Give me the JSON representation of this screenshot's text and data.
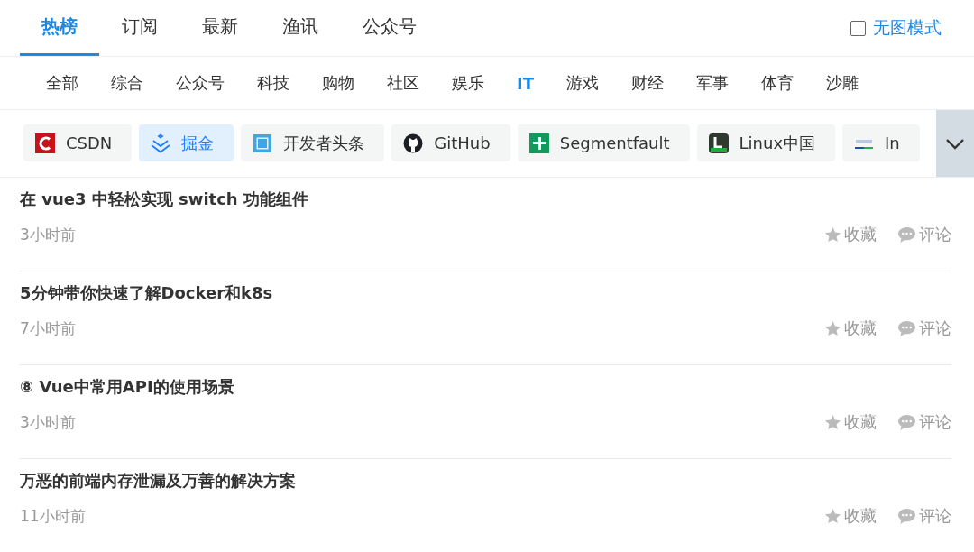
{
  "tabs": [
    {
      "label": "热榜",
      "selected": true
    },
    {
      "label": "订阅",
      "selected": false
    },
    {
      "label": "最新",
      "selected": false
    },
    {
      "label": "渔讯",
      "selected": false
    },
    {
      "label": "公众号",
      "selected": false
    }
  ],
  "no_image_mode": {
    "label": "无图模式",
    "checked": false
  },
  "categories": [
    {
      "label": "全部",
      "selected": false
    },
    {
      "label": "综合",
      "selected": false
    },
    {
      "label": "公众号",
      "selected": false
    },
    {
      "label": "科技",
      "selected": false
    },
    {
      "label": "购物",
      "selected": false
    },
    {
      "label": "社区",
      "selected": false
    },
    {
      "label": "娱乐",
      "selected": false
    },
    {
      "label": "IT",
      "selected": true
    },
    {
      "label": "游戏",
      "selected": false
    },
    {
      "label": "财经",
      "selected": false
    },
    {
      "label": "军事",
      "selected": false
    },
    {
      "label": "体育",
      "selected": false
    },
    {
      "label": "沙雕",
      "selected": false
    }
  ],
  "sources": [
    {
      "name": "CSDN",
      "kind": "csdn",
      "selected": false
    },
    {
      "name": "掘金",
      "kind": "juejin",
      "selected": true
    },
    {
      "name": "开发者头条",
      "kind": "toutiao",
      "selected": false
    },
    {
      "name": "GitHub",
      "kind": "github",
      "selected": false
    },
    {
      "name": "Segmentfault",
      "kind": "sf",
      "selected": false
    },
    {
      "name": "Linux中国",
      "kind": "linux",
      "selected": false
    },
    {
      "name": "In",
      "kind": "infoq",
      "selected": false
    }
  ],
  "articles": [
    {
      "title": "在 vue3 中轻松实现 switch 功能组件",
      "time": "3小时前",
      "favorite": "收藏",
      "comment": "评论"
    },
    {
      "title": "5分钟带你快速了解Docker和k8s",
      "time": "7小时前",
      "favorite": "收藏",
      "comment": "评论"
    },
    {
      "title": "⑧ Vue中常用API的使用场景",
      "time": "3小时前",
      "favorite": "收藏",
      "comment": "评论"
    },
    {
      "title": "万恶的前端内存泄漏及万善的解决方案",
      "time": "11小时前",
      "favorite": "收藏",
      "comment": "评论"
    }
  ]
}
